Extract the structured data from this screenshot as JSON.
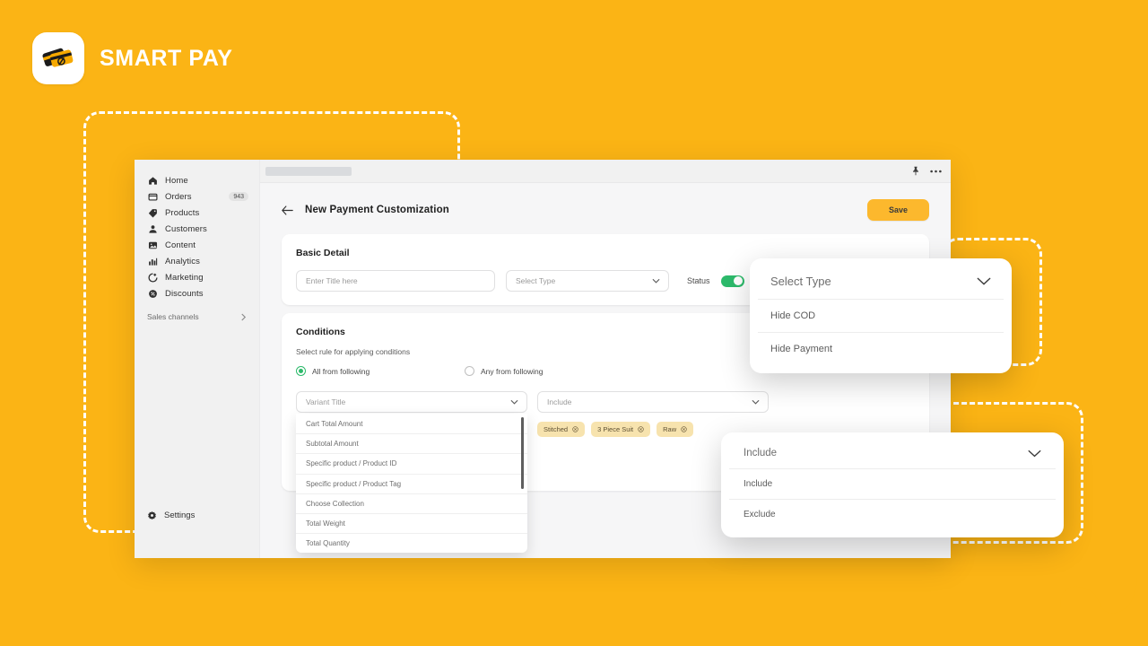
{
  "brand": {
    "name": "SMART PAY",
    "logo_icon": "smart-pay-cards-icon",
    "background_color": "#FBB415"
  },
  "window": {
    "topbar": {
      "pin_icon": "pin-icon",
      "more_icon": "more-horizontal-icon"
    }
  },
  "sidebar": {
    "items": [
      {
        "label": "Home",
        "icon": "home-icon",
        "badge": ""
      },
      {
        "label": "Orders",
        "icon": "orders-icon",
        "badge": "943"
      },
      {
        "label": "Products",
        "icon": "products-icon",
        "badge": ""
      },
      {
        "label": "Customers",
        "icon": "customers-icon",
        "badge": ""
      },
      {
        "label": "Content",
        "icon": "content-icon",
        "badge": ""
      },
      {
        "label": "Analytics",
        "icon": "analytics-icon",
        "badge": ""
      },
      {
        "label": "Marketing",
        "icon": "marketing-icon",
        "badge": ""
      },
      {
        "label": "Discounts",
        "icon": "discounts-icon",
        "badge": ""
      }
    ],
    "sales_channels": {
      "label": "Sales channels",
      "chevron_icon": "chevron-right-icon"
    },
    "settings": {
      "label": "Settings",
      "icon": "gear-icon"
    }
  },
  "page": {
    "back_icon": "arrow-left-icon",
    "title": "New Payment Customization",
    "save_label": "Save"
  },
  "basic_detail": {
    "heading": "Basic Detail",
    "title_placeholder": "Enter Title here",
    "type_placeholder": "Select Type",
    "type_chevron_icon": "chevron-down-icon",
    "status_label": "Status",
    "status_on": true,
    "status_color": "#2DBA6B"
  },
  "conditions": {
    "heading": "Conditions",
    "rule_label": "Select rule for applying conditions",
    "radios": [
      {
        "label": "All from following",
        "selected": true
      },
      {
        "label": "Any from following",
        "selected": false
      }
    ],
    "variant_field": {
      "value": "Variant Title",
      "chevron_icon": "chevron-down-icon"
    },
    "include_field": {
      "value": "Include",
      "chevron_icon": "chevron-down-icon"
    },
    "variant_options": [
      "Cart Total Amount",
      "Subtotal Amount",
      "Specific product / Product ID",
      "Specific product / Product Tag",
      "Choose Collection",
      "Total Weight",
      "Total Quantity"
    ],
    "chips": [
      {
        "label": "Stitched",
        "remove_icon": "remove-circle-icon"
      },
      {
        "label": "3 Piece Suit",
        "remove_icon": "remove-circle-icon"
      },
      {
        "label": "Raw",
        "remove_icon": "remove-circle-icon"
      }
    ],
    "chip_color": "#F7E3AE"
  },
  "popover_type": {
    "header": "Select Type",
    "chevron_icon": "chevron-down-icon",
    "options": [
      "Hide COD",
      "Hide Payment"
    ]
  },
  "popover_include": {
    "header": "Include",
    "chevron_icon": "chevron-down-icon",
    "options": [
      "Include",
      "Exclude"
    ]
  }
}
